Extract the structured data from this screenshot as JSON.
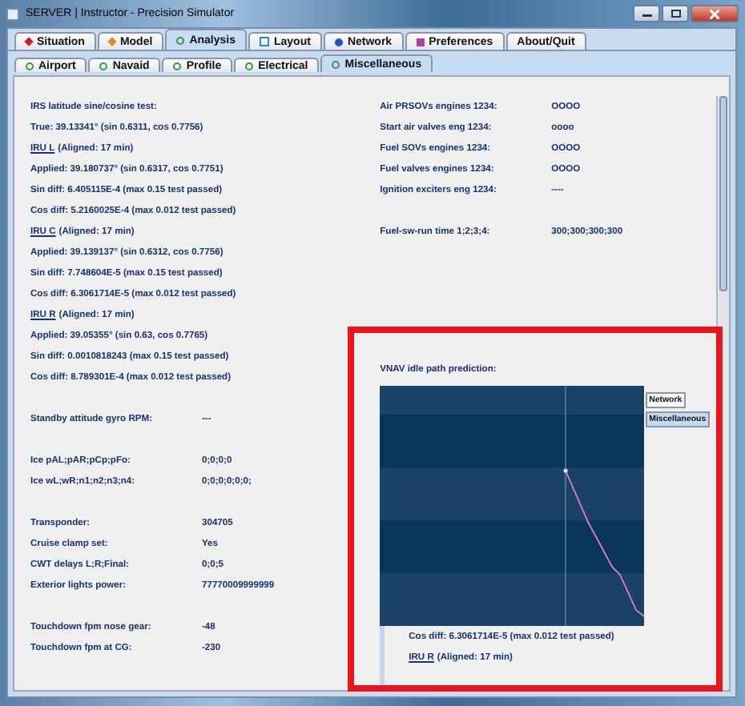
{
  "window": {
    "title": "SERVER | Instructor - Precision Simulator"
  },
  "tabs": [
    {
      "label": "Situation",
      "selected": false,
      "kind": "diamond",
      "color": "#cc2222"
    },
    {
      "label": "Model",
      "selected": false,
      "kind": "diamond",
      "color": "#e08a1e"
    },
    {
      "label": "Analysis",
      "selected": true,
      "kind": "ring",
      "color": "#3a9a3a"
    },
    {
      "label": "Layout",
      "selected": false,
      "kind": "square",
      "color": "#2a8ad0"
    },
    {
      "label": "Network",
      "selected": false,
      "kind": "dot",
      "color": "#2255bb"
    },
    {
      "label": "Preferences",
      "selected": false,
      "kind": "block",
      "color": "#b040b0"
    },
    {
      "label": "About/Quit",
      "selected": false,
      "kind": "plain"
    }
  ],
  "subtabs": [
    {
      "label": "Airport",
      "selected": false,
      "kind": "ring",
      "color": "#3a9a3a"
    },
    {
      "label": "Navaid",
      "selected": false,
      "kind": "ring",
      "color": "#3a9a3a"
    },
    {
      "label": "Profile",
      "selected": false,
      "kind": "ring",
      "color": "#3a9a3a"
    },
    {
      "label": "Electrical",
      "selected": false,
      "kind": "ring",
      "color": "#3a9a3a"
    },
    {
      "label": "Miscellaneous",
      "selected": true,
      "kind": "ring",
      "color": "#3a9a3a"
    }
  ],
  "left_groups": [
    {
      "rows": [
        {
          "kind": "text",
          "text": "IRS latitude sine/cosine test:"
        },
        {
          "kind": "text",
          "text": "True: 39.13341° (sin 0.6311, cos 0.7756)"
        },
        {
          "kind": "unit",
          "unit": "IRU L",
          "text": "(Aligned: 17 min)"
        },
        {
          "kind": "text",
          "text": "Applied: 39.180737° (sin 0.6317, cos 0.7751)"
        },
        {
          "kind": "text",
          "text": "Sin diff: 6.405115E-4 (max 0.15 test passed)"
        },
        {
          "kind": "text",
          "text": "Cos diff: 5.2160025E-4 (max 0.012 test passed)"
        },
        {
          "kind": "unit",
          "unit": "IRU C",
          "text": "(Aligned: 17 min)"
        },
        {
          "kind": "text",
          "text": "Applied: 39.139137° (sin 0.6312, cos 0.7756)"
        },
        {
          "kind": "text",
          "text": "Sin diff: 7.748604E-5 (max 0.15 test passed)"
        },
        {
          "kind": "text",
          "text": "Cos diff: 6.3061714E-5 (max 0.012 test passed)"
        },
        {
          "kind": "unit",
          "unit": "IRU R",
          "text": "(Aligned: 17 min)"
        },
        {
          "kind": "text",
          "text": "Applied: 39.05355° (sin 0.63, cos 0.7765)"
        },
        {
          "kind": "text",
          "text": "Sin diff: 0.0010818243 (max 0.15 test passed)"
        },
        {
          "kind": "text",
          "text": "Cos diff: 8.789301E-4 (max 0.012 test passed)"
        }
      ]
    },
    {
      "rows": [
        {
          "kind": "pair",
          "label": "Standby attitude gyro RPM:",
          "value": "---"
        }
      ]
    },
    {
      "rows": [
        {
          "kind": "pair",
          "label": "Ice pAL;pAR;pCp;pFo:",
          "value": "0;0;0;0"
        },
        {
          "kind": "pair",
          "label": "Ice wL;wR;n1;n2;n3;n4:",
          "value": "0;0;0;0;0;0;"
        }
      ]
    },
    {
      "rows": [
        {
          "kind": "pair",
          "label": "Transponder:",
          "value": "304705"
        },
        {
          "kind": "pair",
          "label": "Cruise clamp set:",
          "value": "Yes"
        },
        {
          "kind": "pair",
          "label": "CWT delays L;R;Final:",
          "value": "0;0;5"
        },
        {
          "kind": "pair",
          "label": "Exterior lights power:",
          "value": "77770009999999"
        }
      ]
    },
    {
      "rows": [
        {
          "kind": "pair",
          "label": "Touchdown fpm nose gear:",
          "value": "-48"
        },
        {
          "kind": "pair",
          "label": "Touchdown fpm at CG:",
          "value": "-230"
        }
      ]
    }
  ],
  "right_groups": [
    {
      "rows": [
        {
          "kind": "pair",
          "label": "Air PRSOVs engines 1234:",
          "value": "OOOO"
        },
        {
          "kind": "pair",
          "label": "Start air valves eng 1234:",
          "value": "oooo"
        },
        {
          "kind": "pair",
          "label": "Fuel SOVs engines 1234:",
          "value": "OOOO"
        },
        {
          "kind": "pair",
          "label": "Fuel valves engines 1234:",
          "value": "OOOO"
        },
        {
          "kind": "pair",
          "label": "Ignition exciters eng 1234:",
          "value": "----"
        }
      ]
    },
    {
      "rows": [
        {
          "kind": "pair",
          "label": "Fuel-sw-run time 1;2;3;4:",
          "value": "300;300;300;300"
        }
      ]
    }
  ],
  "vnav": {
    "title": "VNAV idle path prediction:",
    "residue_tabs": [
      "Network",
      "Miscellaneous"
    ],
    "residue_rows": [
      {
        "kind": "text",
        "text": "Cos diff: 6.3061714E-5 (max 0.012 test passed)"
      },
      {
        "kind": "unit",
        "unit": "IRU R",
        "text": "(Aligned: 17 min)"
      }
    ]
  }
}
